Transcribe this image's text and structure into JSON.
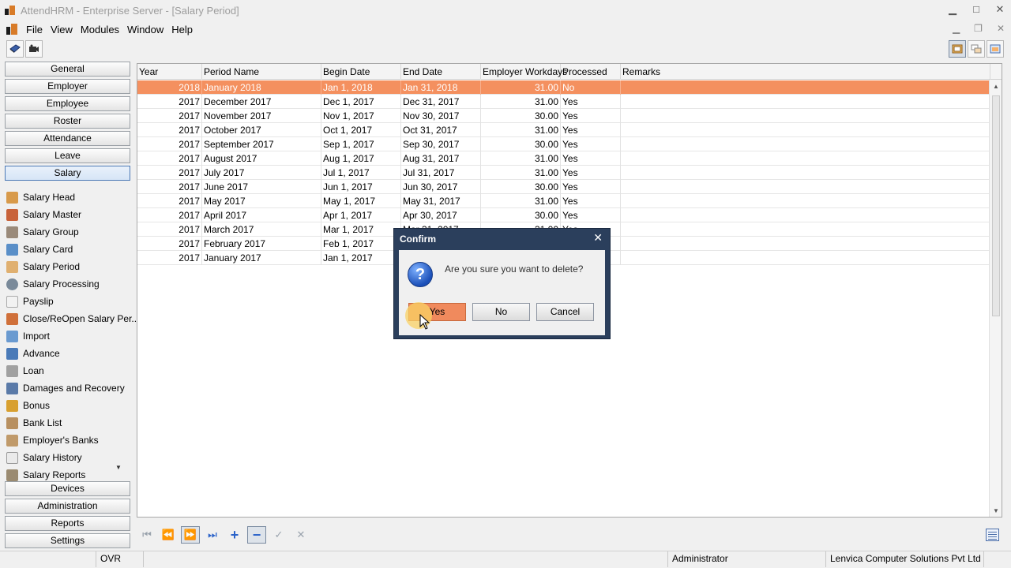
{
  "window": {
    "title": "AttendHRM - Enterprise Server - [Salary Period]"
  },
  "menu": [
    "File",
    "View",
    "Modules",
    "Window",
    "Help"
  ],
  "sidebar": {
    "top_buttons": [
      "General",
      "Employer",
      "Employee",
      "Roster",
      "Attendance",
      "Leave",
      "Salary"
    ],
    "active": "Salary",
    "items": [
      "Salary Head",
      "Salary Master",
      "Salary Group",
      "Salary Card",
      "Salary Period",
      "Salary Processing",
      "Payslip",
      "Close/ReOpen Salary Per...",
      "Import",
      "Advance",
      "Loan",
      "Damages and Recovery",
      "Bonus",
      "Bank List",
      "Employer's Banks",
      "Salary History",
      "Salary Reports"
    ],
    "bottom_buttons": [
      "Devices",
      "Administration",
      "Reports",
      "Settings"
    ]
  },
  "grid": {
    "columns": [
      "Year",
      "Period Name",
      "Begin Date",
      "End Date",
      "Employer Workdays",
      "Processed",
      "Remarks"
    ],
    "rows": [
      [
        "2018",
        "January 2018",
        "Jan 1, 2018",
        "Jan 31, 2018",
        "31.00",
        "No",
        ""
      ],
      [
        "2017",
        "December 2017",
        "Dec 1, 2017",
        "Dec 31, 2017",
        "31.00",
        "Yes",
        ""
      ],
      [
        "2017",
        "November 2017",
        "Nov 1, 2017",
        "Nov 30, 2017",
        "30.00",
        "Yes",
        ""
      ],
      [
        "2017",
        "October 2017",
        "Oct 1, 2017",
        "Oct 31, 2017",
        "31.00",
        "Yes",
        ""
      ],
      [
        "2017",
        "September 2017",
        "Sep 1, 2017",
        "Sep 30, 2017",
        "30.00",
        "Yes",
        ""
      ],
      [
        "2017",
        "August 2017",
        "Aug 1, 2017",
        "Aug 31, 2017",
        "31.00",
        "Yes",
        ""
      ],
      [
        "2017",
        "July 2017",
        "Jul 1, 2017",
        "Jul 31, 2017",
        "31.00",
        "Yes",
        ""
      ],
      [
        "2017",
        "June 2017",
        "Jun 1, 2017",
        "Jun 30, 2017",
        "30.00",
        "Yes",
        ""
      ],
      [
        "2017",
        "May 2017",
        "May 1, 2017",
        "May 31, 2017",
        "31.00",
        "Yes",
        ""
      ],
      [
        "2017",
        "April 2017",
        "Apr 1, 2017",
        "Apr 30, 2017",
        "30.00",
        "Yes",
        ""
      ],
      [
        "2017",
        "March 2017",
        "Mar 1, 2017",
        "Mar 31, 2017",
        "31.00",
        "Yes",
        ""
      ],
      [
        "2017",
        "February 2017",
        "Feb 1, 2017",
        "",
        "",
        "",
        ""
      ],
      [
        "2017",
        "January 2017",
        "Jan 1, 2017",
        "",
        "",
        "",
        ""
      ]
    ],
    "selected_row": 0
  },
  "dialog": {
    "title": "Confirm",
    "message": "Are you sure you want to delete?",
    "yes": "Yes",
    "no": "No",
    "cancel": "Cancel"
  },
  "statusbar": {
    "mode": "OVR",
    "user": "Administrator",
    "company": "Lenvica Computer Solutions Pvt Ltd"
  },
  "colors": {
    "selection": "#f4905f",
    "dialog_frame": "#2b3f5c",
    "accent_blue": "#2a62c9"
  }
}
